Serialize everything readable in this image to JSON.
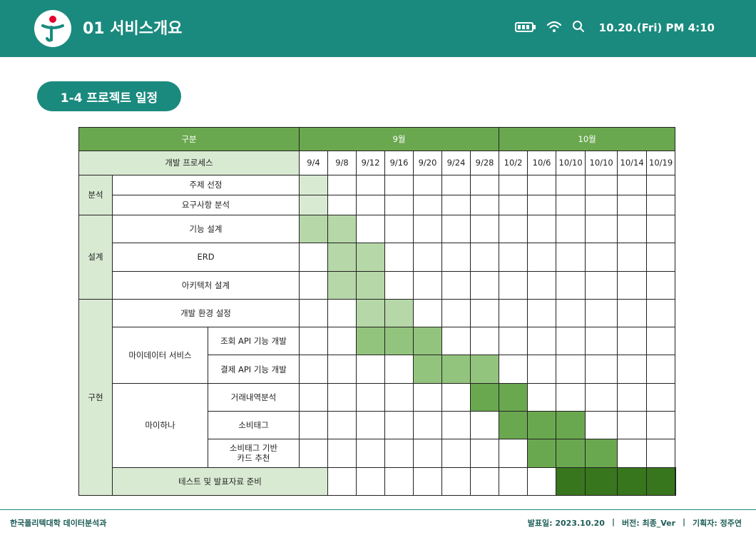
{
  "header": {
    "title": "01 서비스개요",
    "datetime": "10.20.(Fri) PM 4:10",
    "icons": [
      "battery-icon",
      "wifi-icon",
      "search-icon"
    ]
  },
  "section": {
    "label": "1-4 프로젝트 일정"
  },
  "table": {
    "col_group_label": "구분",
    "month_sep": "9월",
    "month_oct": "10월",
    "process_label": "개발 프로세스",
    "dates": [
      "9/4",
      "9/8",
      "9/12",
      "9/16",
      "9/20",
      "9/24",
      "9/28",
      "10/2",
      "10/6",
      "10/10",
      "10/10",
      "10/14",
      "10/19"
    ],
    "cat_analysis": "분석",
    "cat_design": "설계",
    "cat_impl": "구현",
    "sub_mydata": "마이데이터 서비스",
    "sub_myhana": "마이하나",
    "tasks": {
      "t1": "주제 선정",
      "t2": "요구사항 분석",
      "t3": "기능 설계",
      "t4": "ERD",
      "t5": "아키텍처 설계",
      "t6": "개발 환경 설정",
      "t7": "조회 API 기능 개발",
      "t8": "결제 API 기능 개발",
      "t9": "거래내역분석",
      "t10": "소비태그",
      "t11a": "소비태그 기반",
      "t11b": "카드 추천",
      "t12": "테스트 및 발표자료 준비"
    },
    "colors": {
      "header": "#6aa84f",
      "analysis": "#d9ead3",
      "design": "#b6d7a8",
      "impl1": "#93c47d",
      "impl2": "#6aa84f",
      "final": "#38761d"
    }
  },
  "footer": {
    "org": "한국폴리텍대학 데이터분석과",
    "date": "발표일: 2023.10.20",
    "sep1": "|",
    "version": "버전: 최종_Ver",
    "sep2": "|",
    "planner": "기획자: 정주연"
  }
}
